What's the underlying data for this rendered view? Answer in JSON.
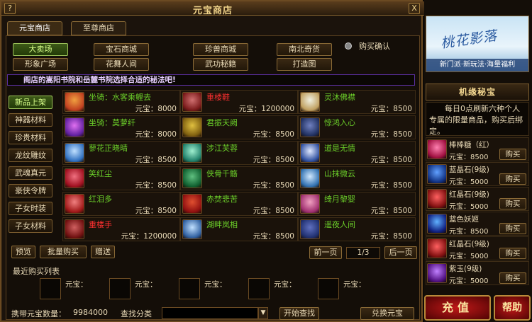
{
  "window": {
    "title": "元宝商店",
    "help_label": "?",
    "close_label": "X"
  },
  "tabs": [
    {
      "label": "元宝商店"
    },
    {
      "label": "至尊商店"
    }
  ],
  "categories": [
    {
      "label": "大卖场"
    },
    {
      "label": "宝石商城"
    },
    {
      "label": "珍兽商城"
    },
    {
      "label": "南北奇货"
    },
    {
      "label": "形象广场"
    },
    {
      "label": "花舞人间"
    },
    {
      "label": "武功秘籍"
    },
    {
      "label": "打造图"
    }
  ],
  "confirm_label": "购买确认",
  "marquee": "阁店的嵩阳书院和岳麓书院选择合适的秘法吧!",
  "side_tabs": [
    {
      "label": "新品上架"
    },
    {
      "label": "神器材料"
    },
    {
      "label": "珍贵材料"
    },
    {
      "label": "龙纹雕纹"
    },
    {
      "label": "武魂真元"
    },
    {
      "label": "豪侠令牌"
    },
    {
      "label": "子女时装"
    },
    {
      "label": "子女材料"
    }
  ],
  "items": [
    {
      "name": "坐骑：水客乘鲤去",
      "price": "元宝：8000",
      "color": "#6cd02a",
      "icon": "fish-mount-icon",
      "c1": "#c04020",
      "c2": "#f0a040"
    },
    {
      "name": "重楼鞋",
      "price": "元宝：1200000",
      "color": "#ff3030",
      "icon": "boots-icon",
      "c1": "#7a1a1a",
      "c2": "#d07070"
    },
    {
      "name": "灵沐佛襟",
      "price": "元宝：8500",
      "color": "#6cd02a",
      "icon": "robe-icon",
      "c1": "#c0a060",
      "c2": "#f0f0e0"
    },
    {
      "name": "坐骑：莫萝纤",
      "price": "元宝：8000",
      "color": "#6cd02a",
      "icon": "butterfly-mount-icon",
      "c1": "#6020a0",
      "c2": "#e070f0"
    },
    {
      "name": "君振天阙",
      "price": "元宝：8500",
      "color": "#6cd02a",
      "icon": "robe-icon",
      "c1": "#806010",
      "c2": "#e0c040"
    },
    {
      "name": "惊鸿入心",
      "price": "元宝：8500",
      "color": "#6cd02a",
      "icon": "robe-icon",
      "c1": "#203060",
      "c2": "#7080c0"
    },
    {
      "name": "蓼花正晓晴",
      "price": "元宝：8500",
      "color": "#6cd02a",
      "icon": "robe-icon",
      "c1": "#3070c0",
      "c2": "#c0e0ff"
    },
    {
      "name": "涉江芙蓉",
      "price": "元宝：8500",
      "color": "#6cd02a",
      "icon": "robe-icon",
      "c1": "#20806a",
      "c2": "#a0f0d0"
    },
    {
      "name": "道是无情",
      "price": "元宝：8500",
      "color": "#6cd02a",
      "icon": "robe-icon",
      "c1": "#3050a0",
      "c2": "#e0e8ff"
    },
    {
      "name": "笑红尘",
      "price": "元宝：8500",
      "color": "#6cd02a",
      "icon": "robe-icon",
      "c1": "#a01020",
      "c2": "#f07080"
    },
    {
      "name": "侠骨千觞",
      "price": "元宝：8500",
      "color": "#6cd02a",
      "icon": "robe-icon",
      "c1": "#106030",
      "c2": "#60c080"
    },
    {
      "name": "山抹微云",
      "price": "元宝：8500",
      "color": "#6cd02a",
      "icon": "robe-icon",
      "c1": "#3070b0",
      "c2": "#d0e8ff"
    },
    {
      "name": "红泪多",
      "price": "元宝：8500",
      "color": "#6cd02a",
      "icon": "robe-icon",
      "c1": "#a01818",
      "c2": "#f08080"
    },
    {
      "name": "赤焚悲苦",
      "price": "元宝：8500",
      "color": "#6cd02a",
      "icon": "robe-icon",
      "c1": "#901010",
      "c2": "#e05030"
    },
    {
      "name": "绮月黎婴",
      "price": "元宝：8500",
      "color": "#6cd02a",
      "icon": "robe-icon",
      "c1": "#a03070",
      "c2": "#f0a0c0"
    },
    {
      "name": "重楼手",
      "price": "元宝：1200000",
      "color": "#ff3030",
      "icon": "glove-icon",
      "c1": "#701010",
      "c2": "#d06060"
    },
    {
      "name": "湖畔岚相",
      "price": "元宝：8500",
      "color": "#6cd02a",
      "icon": "robe-icon",
      "c1": "#3060a0",
      "c2": "#c0e0ff"
    },
    {
      "name": "遥夜人间",
      "price": "元宝：8500",
      "color": "#6cd02a",
      "icon": "robe-icon",
      "c1": "#203070",
      "c2": "#6070c0"
    }
  ],
  "actions": {
    "preview": "预览",
    "bulk_buy": "批量购买",
    "gift": "赠送",
    "prev": "前一页",
    "page": "1/3",
    "next": "后一页"
  },
  "recent": {
    "title": "最近购买列表",
    "slot_label": "元宝："
  },
  "footer": {
    "currency_label": "携带元宝数量：",
    "currency_value": "9984000",
    "search_label": "查找分类",
    "search_value": "",
    "search_button": "开始查找",
    "exchange_button": "兑换元宝"
  },
  "banner": {
    "title": "桃花影落",
    "bar": "新门派·新玩法·海量福利"
  },
  "secret": {
    "title": "机缘秘宝",
    "desc": "每日0点刷新六种个人专属的限量商品，购买后绑定。",
    "buy_label": "购买",
    "items": [
      {
        "name": "棒棒糖（红）",
        "price": "元宝：8500",
        "icon": "lollipop-icon",
        "c1": "#a01040",
        "c2": "#ff80b0"
      },
      {
        "name": "蓝晶石(9级)",
        "price": "元宝：5000",
        "icon": "blue-gem-icon",
        "c1": "#103080",
        "c2": "#60a0ff"
      },
      {
        "name": "红晶石(9级)",
        "price": "元宝：5000",
        "icon": "red-gem-icon",
        "c1": "#801010",
        "c2": "#ff6060"
      },
      {
        "name": "蓝色妖姬",
        "price": "元宝：8500",
        "icon": "blue-rose-icon",
        "c1": "#102080",
        "c2": "#60b0ff"
      },
      {
        "name": "红晶石(9级)",
        "price": "元宝：5000",
        "icon": "red-gem-icon",
        "c1": "#801010",
        "c2": "#ff6060"
      },
      {
        "name": "紫玉(9级)",
        "price": "元宝：5000",
        "icon": "purple-jade-icon",
        "c1": "#501080",
        "c2": "#c080ff"
      }
    ]
  },
  "bottom_buttons": {
    "recharge": "充值",
    "help": "帮助"
  }
}
